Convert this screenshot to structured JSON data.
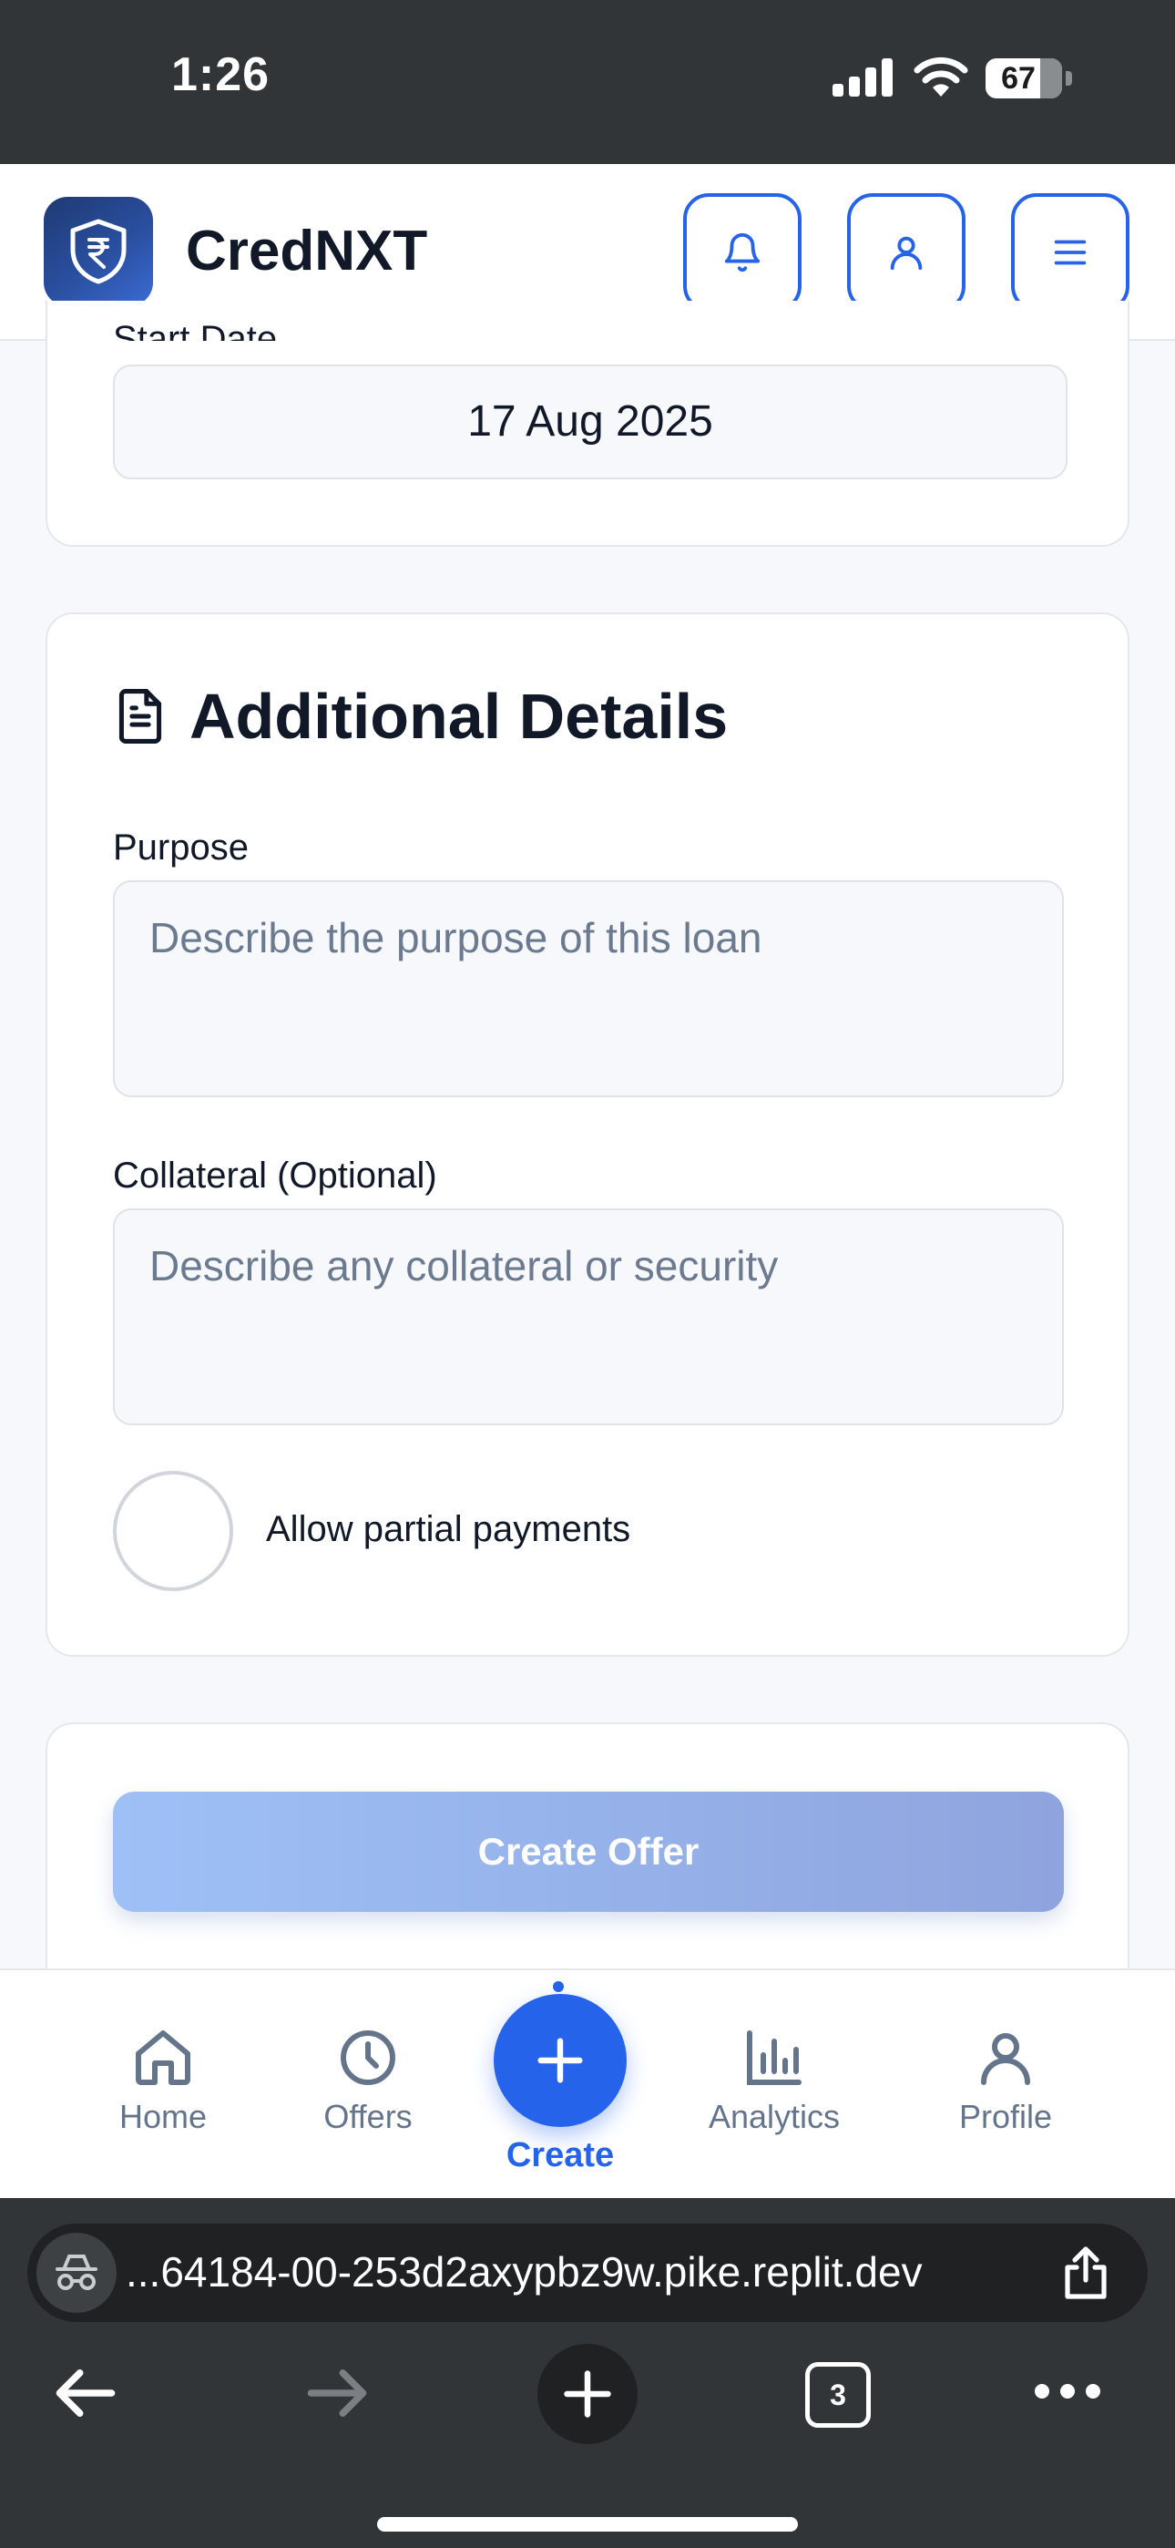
{
  "status_bar": {
    "time": "1:26",
    "battery": "67",
    "icons": [
      "signal-icon",
      "wifi-icon",
      "battery-icon"
    ]
  },
  "header": {
    "brand": "CredNXT",
    "logo_icon": "rupee-shield-icon",
    "buttons": [
      "bell-icon",
      "user-icon",
      "menu-icon"
    ],
    "accent": "#2563eb"
  },
  "form": {
    "start_date_label": "Start Date",
    "start_date_value": "17 Aug 2025",
    "additional": {
      "title": "Additional Details",
      "icon": "document-icon",
      "purpose_label": "Purpose",
      "purpose_placeholder": "Describe the purpose of this loan",
      "purpose_value": "",
      "collateral_label": "Collateral (Optional)",
      "collateral_placeholder": "Describe any collateral or security",
      "collateral_value": "",
      "partial_payments_label": "Allow partial payments",
      "partial_payments_checked": false
    },
    "submit_label": "Create Offer"
  },
  "nav": {
    "items": [
      {
        "label": "Home",
        "icon": "home-icon"
      },
      {
        "label": "Offers",
        "icon": "clock-icon"
      },
      {
        "label": "Create",
        "icon": "plus-icon"
      },
      {
        "label": "Analytics",
        "icon": "bar-chart-icon"
      },
      {
        "label": "Profile",
        "icon": "user-icon"
      }
    ],
    "active": "Create"
  },
  "browser": {
    "url": "...64184-00-253d2axypbz9w.pike.replit.dev",
    "tab_count": "3"
  }
}
